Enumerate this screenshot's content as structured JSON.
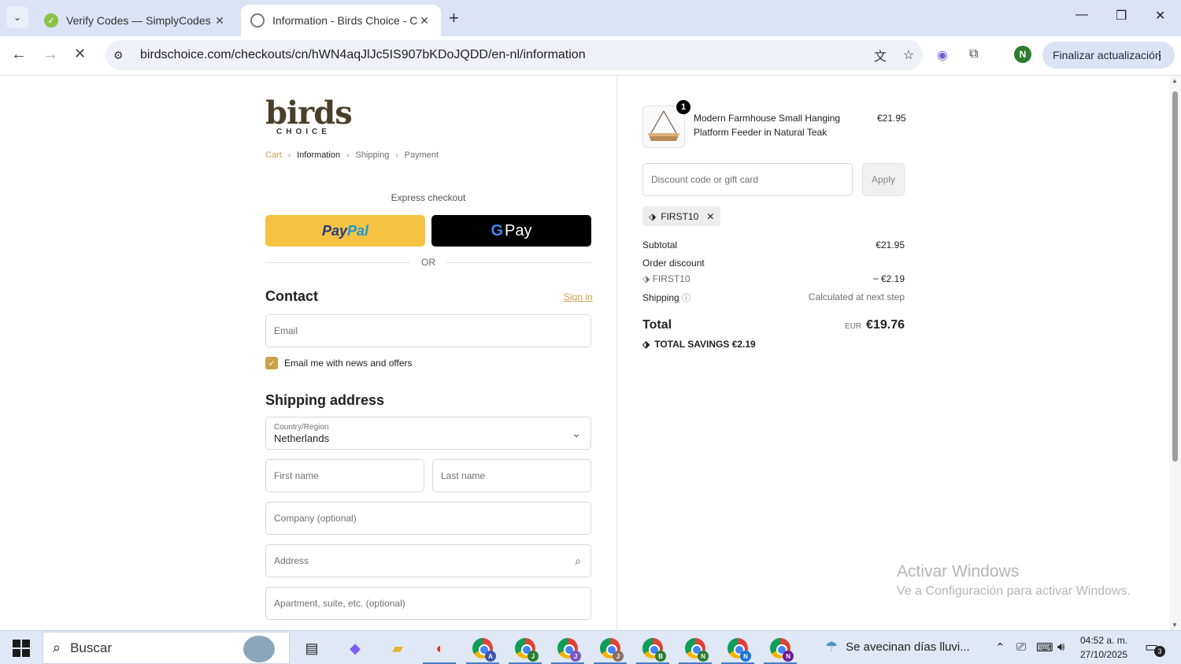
{
  "browser": {
    "tabs": [
      {
        "title": "Verify Codes — SimplyCodes",
        "active": false
      },
      {
        "title": "Information - Birds Choice - Ch",
        "active": true
      }
    ],
    "url": "birdschoice.com/checkouts/cn/hWN4aqJlJc5IS907bKDoJQDD/en-nl/information",
    "profile_initial": "N",
    "update_label": "Finalizar actualización"
  },
  "checkout": {
    "logo_main": "birds",
    "logo_sub": "CHOICE",
    "breadcrumb": [
      "Cart",
      "Information",
      "Shipping",
      "Payment"
    ],
    "express_label": "Express checkout",
    "paypal_a": "Pay",
    "paypal_b": "Pal",
    "gpay_g": "G",
    "gpay_label": "Pay",
    "or_label": "OR",
    "contact_title": "Contact",
    "signin_label": "Sign in",
    "email_placeholder": "Email",
    "newsletter_label": "Email me with news and offers",
    "newsletter_checked": true,
    "shipping_title": "Shipping address",
    "country_label": "Country/Region",
    "country_value": "Netherlands",
    "first_name_placeholder": "First name",
    "last_name_placeholder": "Last name",
    "company_placeholder": "Company (optional)",
    "address_placeholder": "Address",
    "apartment_placeholder": "Apartment, suite, etc. (optional)"
  },
  "summary": {
    "item": {
      "quantity": "1",
      "name": "Modern Farmhouse Small Hanging Platform Feeder in Natural Teak",
      "price": "€21.95"
    },
    "discount_placeholder": "Discount code or gift card",
    "apply_label": "Apply",
    "applied_code": "FIRST10",
    "subtotal_label": "Subtotal",
    "subtotal_value": "€21.95",
    "order_discount_label": "Order discount",
    "discount_code": "FIRST10",
    "discount_value": "− €2.19",
    "shipping_label": "Shipping",
    "shipping_value": "Calculated at next step",
    "total_label": "Total",
    "total_currency": "EUR",
    "total_value": "€19.76",
    "savings_label": "TOTAL SAVINGS",
    "savings_value": "€2.19"
  },
  "watermark": {
    "line1": "Activar Windows",
    "line2": "Ve a Configuración para activar Windows."
  },
  "taskbar": {
    "search_label": "Buscar",
    "weather_text": "Se avecinan días lluvi...",
    "time": "04:52 a. m.",
    "date": "27/10/2025",
    "notifications": "3",
    "chrome_profiles": [
      "A",
      "J",
      "J",
      "J",
      "B",
      "N",
      "N",
      "N"
    ]
  }
}
